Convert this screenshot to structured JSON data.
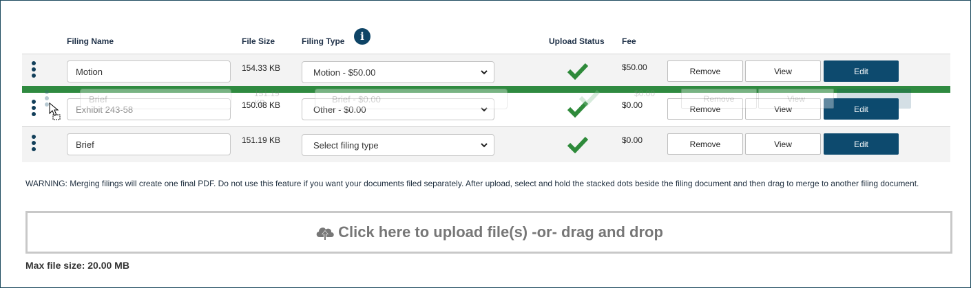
{
  "headers": {
    "filing_name": "Filing Name",
    "file_size": "File Size",
    "filing_type": "Filing Type",
    "upload_status": "Upload Status",
    "fee": "Fee"
  },
  "rows": [
    {
      "filing_name": "Motion",
      "file_size": "154.33 KB",
      "filing_type": "Motion - $50.00",
      "fee": "$50.00"
    },
    {
      "filing_name": "",
      "placeholder": "Exhibit 243-58",
      "file_size": "150.08 KB",
      "filing_type": "Other - $0.00",
      "fee": "$0.00"
    },
    {
      "filing_name": "Brief",
      "file_size": "151.19 KB",
      "filing_type": "Select filing type",
      "fee": "$0.00"
    }
  ],
  "drag_ghost": {
    "filing_name": "Brief",
    "file_size": "151.19 KB",
    "filing_type": "Brief - $0.00",
    "fee": "$0.00",
    "remove": "Remove",
    "view": "View"
  },
  "buttons": {
    "remove": "Remove",
    "view": "View",
    "edit": "Edit"
  },
  "warning": "WARNING: Merging filings will create one final PDF. Do not use this feature if you want your documents filed separately. After upload, select and hold the stacked dots beside the filing document and then drag to merge to another filing document.",
  "upload_text": "Click here to upload file(s) -or- drag and drop",
  "max_file_size": "Max file size: 20.00 MB",
  "colors": {
    "primary": "#0d4a6e",
    "success": "#2f8a40",
    "text": "#1f3148"
  },
  "icons": [
    "info-icon",
    "drag-handle-icon",
    "check-icon",
    "chevron-down-icon",
    "cloud-upload-icon",
    "cursor-icon"
  ]
}
